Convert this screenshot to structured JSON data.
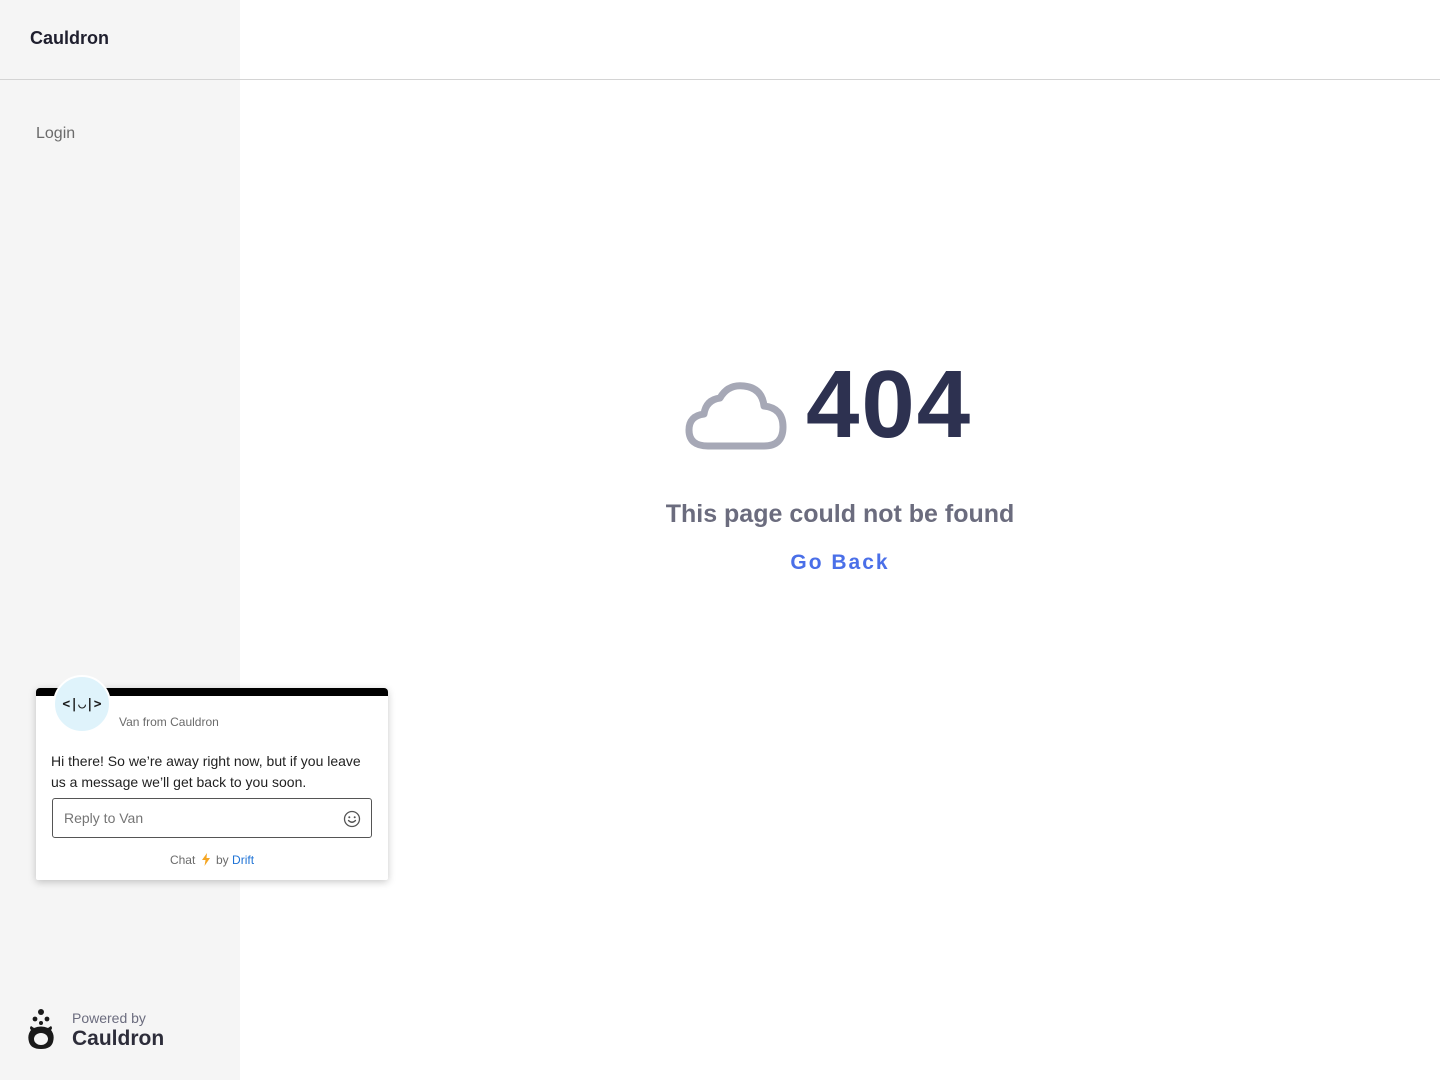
{
  "sidebar": {
    "brand": "Cauldron",
    "nav": [
      {
        "label": "Login"
      }
    ],
    "powered_by": {
      "label": "Powered by",
      "brand": "Cauldron"
    }
  },
  "error": {
    "code": "404",
    "message": "This page could not be found",
    "back_label": "Go Back",
    "icon": "cloud-icon"
  },
  "chat": {
    "avatar_text": "<|◡|>",
    "sender": "Van from Cauldron",
    "message": "Hi there! So we’re away right now, but if you leave us a message we’ll get back to you soon.",
    "input_placeholder": "Reply to Van",
    "footer_prefix": "Chat",
    "footer_by": "by",
    "footer_brand": "Drift"
  },
  "colors": {
    "accent": "#4a6fe8",
    "code": "#2d3150",
    "muted": "#6b6c7e",
    "chat_header": "#000000",
    "drift_link": "#1f73d6",
    "bolt": "#f5a623"
  }
}
